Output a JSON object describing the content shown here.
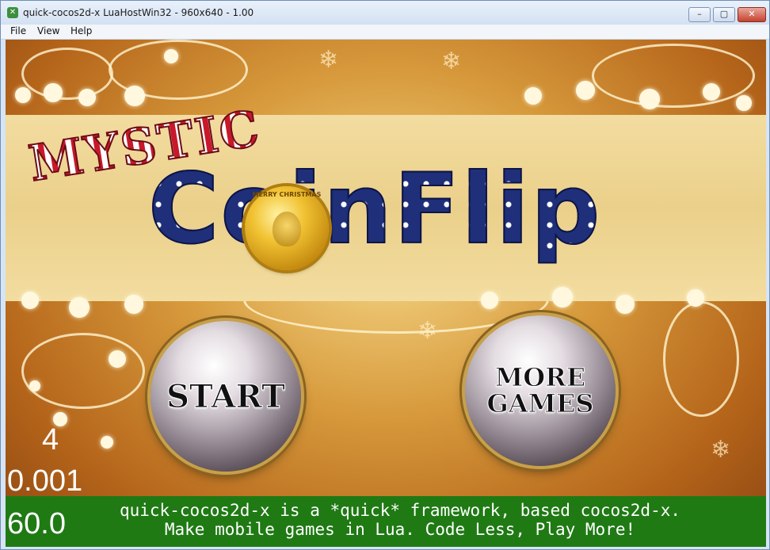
{
  "window": {
    "title": "quick-cocos2d-x LuaHostWin32 - 960x640 - 1.00",
    "app_icon": "cocos-icon",
    "controls": {
      "minimize": "–",
      "maximize": "▢",
      "close": "✕"
    }
  },
  "menu": {
    "items": [
      "File",
      "View",
      "Help"
    ]
  },
  "game": {
    "logo": {
      "line1": "MYSTIC",
      "line2": "CoinFlip"
    },
    "coin_text": "MERRY CHRISTMAS",
    "buttons": {
      "start": "START",
      "more_games_line1": "MORE",
      "more_games_line2": "GAMES"
    },
    "debug_stats": {
      "draw_calls": "4",
      "frame_time": "0.001",
      "fps": "60.0"
    },
    "footer": {
      "line1": "quick-cocos2d-x is a *quick* framework, based cocos2d-x.",
      "line2": "Make mobile games in Lua. Code Less, Play More!"
    },
    "colors": {
      "footer_bg": "#1f7a14",
      "logo_blue": "#1f2f7a",
      "logo_red": "#c8182a",
      "coin_gold": "#f1c232"
    }
  }
}
